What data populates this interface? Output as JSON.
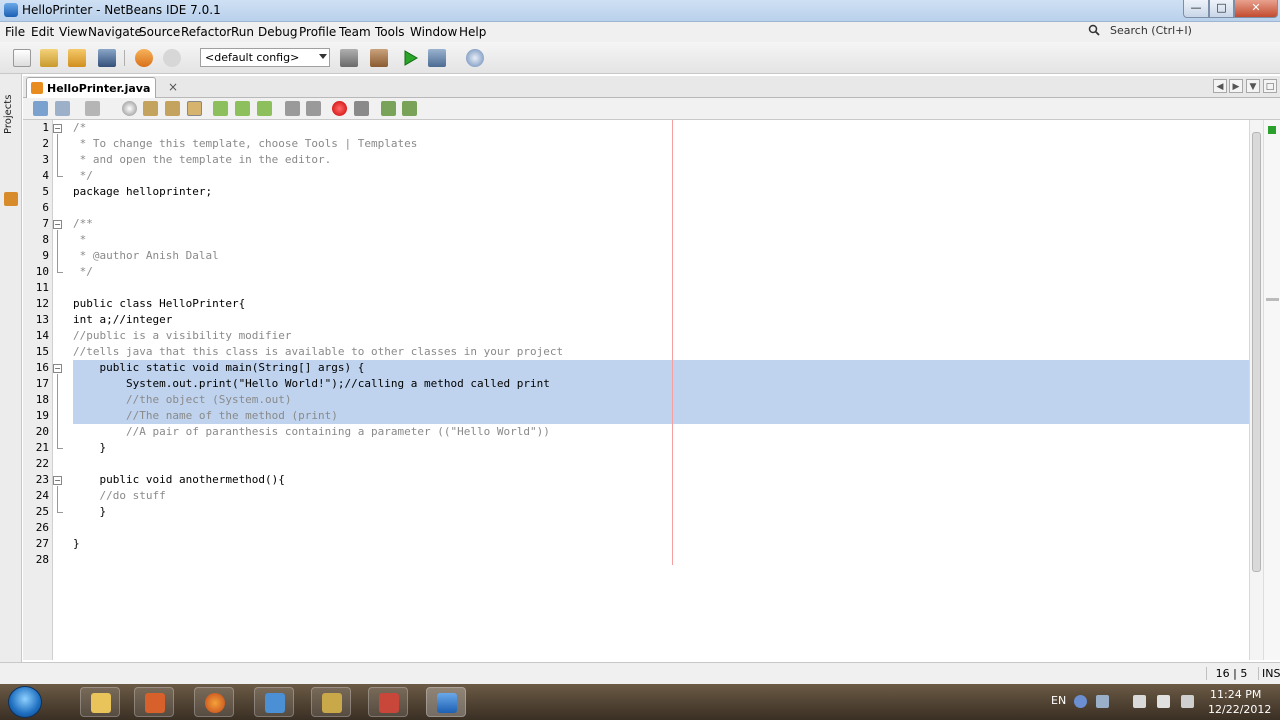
{
  "window": {
    "title": "HelloPrinter - NetBeans IDE 7.0.1"
  },
  "menu": [
    "File",
    "Edit",
    "View",
    "Navigate",
    "Source",
    "Refactor",
    "Run",
    "Debug",
    "Profile",
    "Team",
    "Tools",
    "Window",
    "Help"
  ],
  "search": {
    "placeholder": "Search (Ctrl+I)"
  },
  "toolbar": {
    "config_value": "<default config>"
  },
  "sidebar": {
    "projects_tab": "Projects"
  },
  "editor": {
    "tab_label": "HelloPrinter.java",
    "caret_position": "16 | 5",
    "insert_mode": "INS",
    "selected_lines": [
      16,
      20
    ],
    "lines": [
      "/*",
      " * To change this template, choose Tools | Templates",
      " * and open the template in the editor.",
      " */",
      "package helloprinter;",
      "",
      "/**",
      " *",
      " * @author Anish Dalal",
      " */",
      "",
      "public class HelloPrinter{",
      "int a;//integer",
      "//public is a visibility modifier",
      "//tells java that this class is available to other classes in your project",
      "    public static void main(String[] args) {",
      "        System.out.print(\"Hello World!\");//calling a method called print",
      "        //the object (System.out)",
      "        //The name of the method (print)",
      "        //A pair of paranthesis containing a parameter ((\"Hello World\"))",
      "    }",
      "",
      "    public void anothermethod(){",
      "    //do stuff",
      "    }",
      "",
      "}",
      ""
    ]
  },
  "taskbar": {
    "language": "EN",
    "time": "11:24 PM",
    "date": "12/22/2012"
  }
}
